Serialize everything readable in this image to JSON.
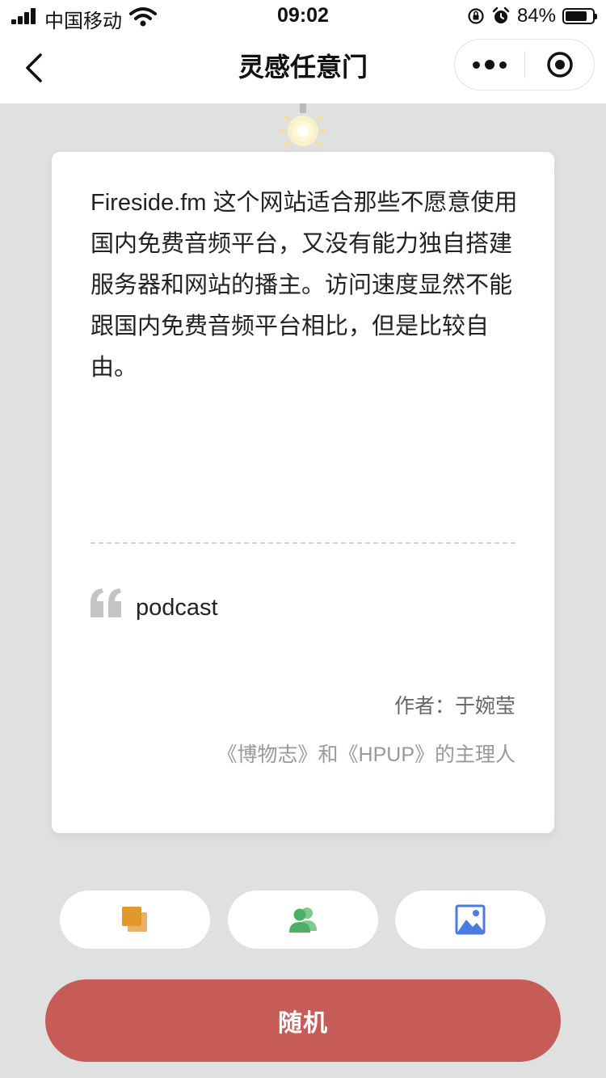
{
  "status_bar": {
    "carrier": "中国移动",
    "time": "09:02",
    "battery_percent": "84%",
    "battery_level": 0.84
  },
  "nav": {
    "title": "灵感任意门"
  },
  "card": {
    "content": "Fireside.fm 这个网站适合那些不愿意使用国内免费音频平台，又没有能力独自搭建服务器和网站的播主。访问速度显然不能跟国内免费音频平台相比，但是比较自由。",
    "tag": "podcast",
    "author": "作者：于婉莹",
    "author_intro": "《博物志》和《HPUP》的主理人"
  },
  "actions": {
    "icons": [
      "copy-icon",
      "users-icon",
      "image-icon"
    ],
    "random_label": "随机"
  },
  "colors": {
    "background": "#dfe1e1",
    "primary_button": "#c75b58",
    "copy_icon": "#e09a2c",
    "users_icon": "#4caf67",
    "image_icon": "#4a7be0"
  }
}
